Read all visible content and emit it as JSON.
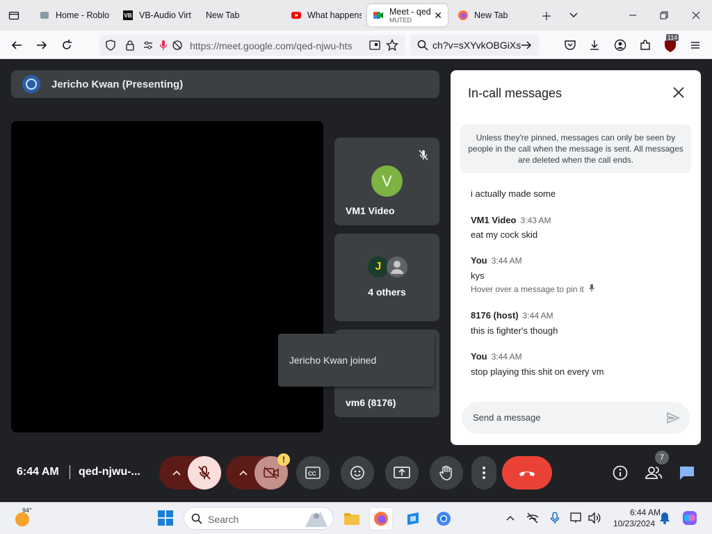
{
  "browser": {
    "tabs": [
      {
        "label": "Home - Roblo",
        "icon": "roblox-icon"
      },
      {
        "label": "VB-Audio Virt",
        "icon": "vb-audio-icon"
      },
      {
        "label": "New Tab",
        "icon": "none"
      },
      {
        "label": "What happens",
        "icon": "youtube-icon"
      },
      {
        "label": "Meet - qed",
        "sublabel": "MUTED",
        "icon": "meet-icon",
        "active": true
      },
      {
        "label": "New Tab",
        "icon": "firefox-icon"
      }
    ],
    "url": "https://meet.google.com/qed-njwu-hts",
    "search_text": "ch?v=sXYvkOBGiXs",
    "extension_badge": "114"
  },
  "meet": {
    "presenter_label": "Jericho Kwan (Presenting)",
    "tiles": [
      {
        "name": "VM1 Video",
        "avatar_letter": "V",
        "avatar_color": "#7cb342",
        "muted": true
      },
      {
        "name": "4 others",
        "avatar_letter": "J"
      },
      {
        "name": "vm6 (8176)"
      }
    ],
    "toast": "Jericho Kwan joined",
    "time": "6:44 AM",
    "meeting_code": "qed-njwu-...",
    "participant_count": "7",
    "warning_mark": "!"
  },
  "chat": {
    "title": "In-call messages",
    "notice": "Unless they're pinned, messages can only be seen by people in the call when the message is sent. All messages are deleted when the call ends.",
    "messages": [
      {
        "text": "i actually made some"
      },
      {
        "sender": "VM1 Video",
        "time": "3:43 AM",
        "text": "eat my cock skid"
      },
      {
        "sender": "You",
        "time": "3:44 AM",
        "text": "kys",
        "hint": "Hover over a message to pin it"
      },
      {
        "sender": "8176 (host)",
        "time": "3:44 AM",
        "text": "this is fighter's though"
      },
      {
        "sender": "You",
        "time": "3:44 AM",
        "text": "stop playing this shit on every vm"
      }
    ],
    "input_placeholder": "Send a message"
  },
  "taskbar": {
    "temperature": "94°",
    "search_label": "Search",
    "clock_time": "6:44 AM",
    "clock_date": "10/23/2024"
  },
  "colors": {
    "meet_bg": "#202124",
    "tile_bg": "#3c4043",
    "end_call_red": "#ea4335",
    "muted_red_pill": "#f9dedc",
    "chat_accent": "#8ab4f8"
  }
}
